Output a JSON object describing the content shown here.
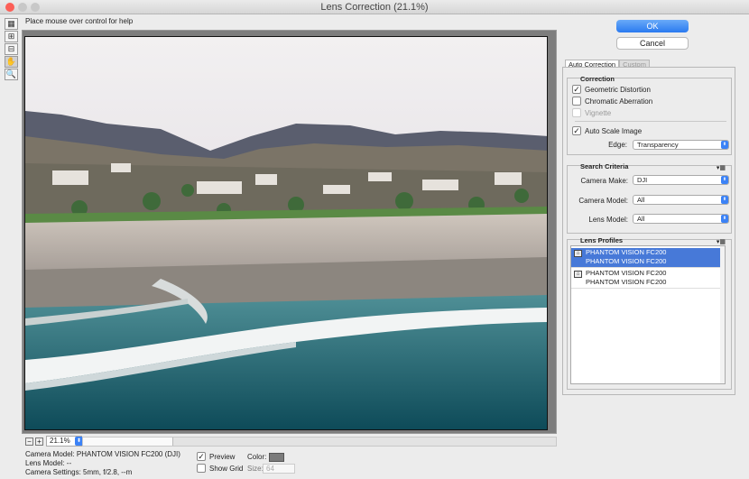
{
  "window": {
    "title": "Lens Correction (21.1%)"
  },
  "help_text": "Place mouse over control for help",
  "tools": [
    {
      "icon": "remove-distortion-icon"
    },
    {
      "icon": "straighten-icon"
    },
    {
      "icon": "move-grid-icon"
    },
    {
      "icon": "hand-icon"
    },
    {
      "icon": "zoom-icon"
    }
  ],
  "zoom": {
    "value": "21.1%"
  },
  "info": {
    "camera_model": "Camera Model: PHANTOM VISION FC200 (DJI)",
    "lens_model": "Lens Model: --",
    "camera_settings": "Camera Settings: 5mm, f/2.8, --m"
  },
  "options": {
    "preview_label": "Preview",
    "show_grid_label": "Show Grid",
    "color_label": "Color:",
    "size_label": "Size:",
    "size_value": "64",
    "grid_color": "#7b7b7b"
  },
  "buttons": {
    "ok": "OK",
    "cancel": "Cancel"
  },
  "tabs": [
    {
      "label": "Auto Correction"
    },
    {
      "label": "Custom"
    }
  ],
  "correction": {
    "title": "Correction",
    "geometric": "Geometric Distortion",
    "chromatic": "Chromatic Aberration",
    "vignette": "Vignette",
    "auto_scale": "Auto Scale Image",
    "edge_label": "Edge:",
    "edge_value": "Transparency"
  },
  "search": {
    "title": "Search Criteria",
    "make_label": "Camera Make:",
    "make_value": "DJI",
    "model_label": "Camera Model:",
    "model_value": "All",
    "lens_label": "Lens Model:",
    "lens_value": "All"
  },
  "profiles": {
    "title": "Lens Profiles",
    "items": [
      {
        "line1": "PHANTOM VISION FC200",
        "line2": "PHANTOM VISION FC200"
      },
      {
        "line1": "PHANTOM VISION FC200",
        "line2": "PHANTOM VISION FC200"
      }
    ]
  },
  "colors": {
    "accent": "#3b82f6",
    "selection": "#4779d8"
  }
}
